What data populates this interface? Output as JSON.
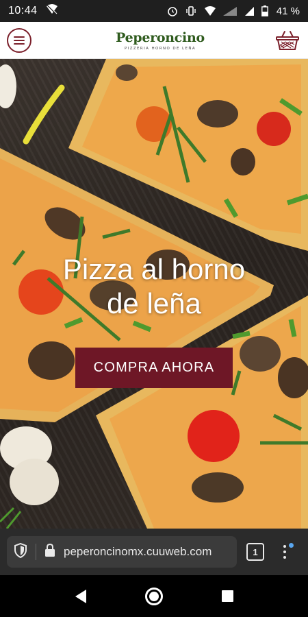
{
  "status_bar": {
    "time": "10:44",
    "battery": "41 %",
    "icons": [
      "wifi-off-icon",
      "alarm-icon",
      "vibrate-icon",
      "wifi-icon",
      "signal-4g-icon",
      "signal-icon",
      "battery-icon"
    ]
  },
  "header": {
    "brand_name": "Peperoncino",
    "brand_tagline": "PIZZERIA HORNO DE LEÑA",
    "brand_color": "#2f5b1e",
    "accent_color": "#7b1f2a"
  },
  "hero": {
    "title_line1": "Pizza al horno",
    "title_line2": "de leña",
    "cta_label": "COMPRA AHORA",
    "cta_color": "#6e1726"
  },
  "browser": {
    "url": "peperoncinomx.cuuweb.com",
    "tab_count": "1"
  }
}
